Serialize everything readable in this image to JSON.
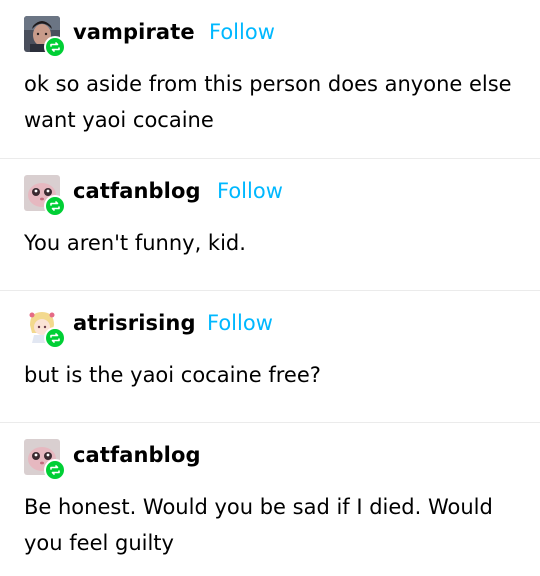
{
  "posts": [
    {
      "username": "vampirate",
      "follow_label": "Follow",
      "text": "ok so aside from this person does anyone else want yaoi cocaine",
      "avatar_icon": "dark-portrait-avatar"
    },
    {
      "username": "catfanblog",
      "follow_label": "Follow",
      "text": "You aren't funny, kid.",
      "avatar_icon": "pink-cat-avatar"
    },
    {
      "username": "atrisrising",
      "follow_label": "Follow",
      "text": "but is the yaoi cocaine free?",
      "avatar_icon": "anime-character-avatar"
    },
    {
      "username": "catfanblog",
      "text": "Be honest. Would you be sad if I died. Would you feel guilty",
      "avatar_icon": "pink-cat-avatar"
    }
  ],
  "colors": {
    "follow": "#00b8ff",
    "reblog_badge": "#00cf35",
    "divider": "#ebebeb"
  },
  "icons": {
    "badge": "reblog-icon"
  }
}
